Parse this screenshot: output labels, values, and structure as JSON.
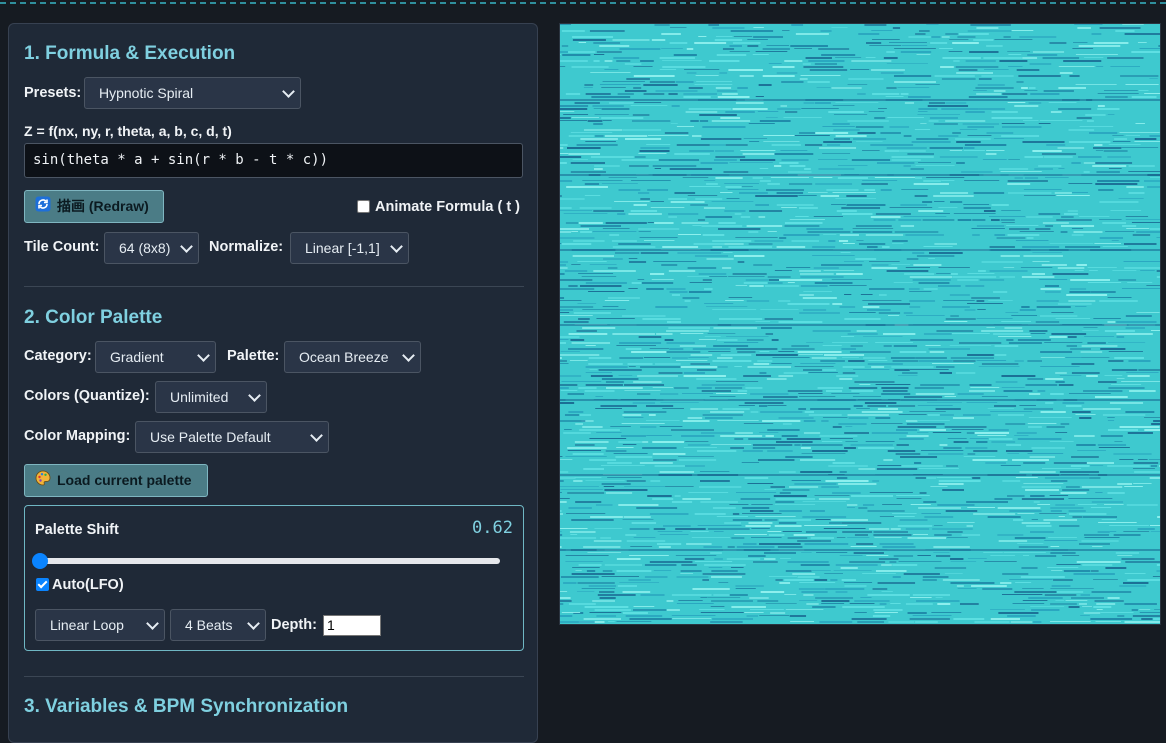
{
  "sections": {
    "s1": "1. Formula & Execution",
    "s2": "2. Color Palette",
    "s3": "3. Variables & BPM Synchronization"
  },
  "formula": {
    "presets_label": "Presets:",
    "preset_value": "Hypnotic Spiral",
    "expression_label": "Z = f(nx, ny, r, theta, a, b, c, d, t)",
    "expression": "sin(theta * a + sin(r * b - t * c))",
    "redraw_label": "描画 (Redraw)",
    "animate_label": "Animate Formula ( t )",
    "animate_checked": false,
    "tile_label": "Tile Count:",
    "tile_value": "64 (8x8)",
    "normalize_label": "Normalize:",
    "normalize_value": "Linear [-1,1]"
  },
  "palette": {
    "category_label": "Category:",
    "category_value": "Gradient",
    "palette_label": "Palette:",
    "palette_value": "Ocean Breeze",
    "quantize_label": "Colors (Quantize):",
    "quantize_value": "Unlimited",
    "mapping_label": "Color Mapping:",
    "mapping_value": "Use Palette Default",
    "load_label": "Load current palette",
    "shift_label": "Palette Shift",
    "shift_value": "0.62",
    "shift_slider_fraction": 0.0,
    "auto_label": "Auto(LFO)",
    "auto_checked": true,
    "lfo_mode_value": "Linear Loop",
    "lfo_beats_value": "4 Beats",
    "depth_label": "Depth:",
    "depth_value": "1"
  },
  "colors": {
    "accent": "#7fd0e0",
    "panel_bg": "#1f2937",
    "page_bg": "#161b22",
    "button_bg": "#4b7c86",
    "canvas_light": "#3ec9cf",
    "canvas_dark": "#1b6e95"
  },
  "icons": {
    "redraw": "refresh-icon",
    "load": "palette-icon"
  }
}
